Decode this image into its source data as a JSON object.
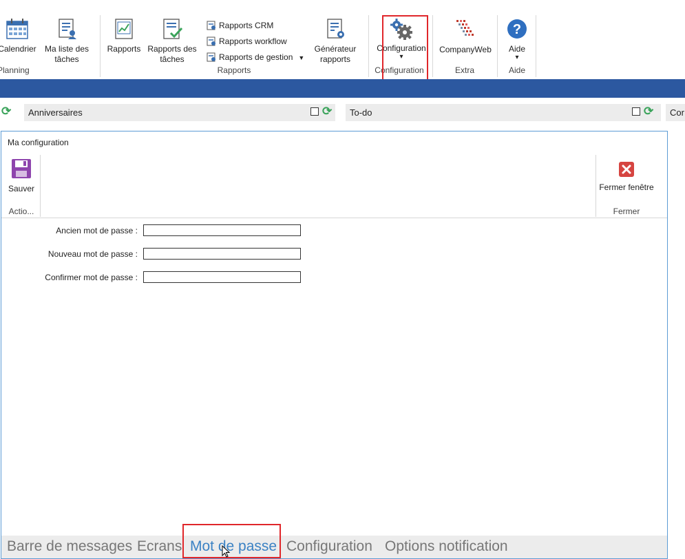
{
  "ribbon": {
    "planning": {
      "calendar_label": "Calendrier",
      "tasks_label_1": "Ma liste des",
      "tasks_label_2": "tâches",
      "group": "Planning"
    },
    "reports": {
      "rapports_label": "Rapports",
      "task_reports_1": "Rapports des",
      "task_reports_2": "tâches",
      "crm": "Rapports CRM",
      "workflow": "Rapports workflow",
      "management": "Rapports de gestion",
      "generator_1": "Générateur",
      "generator_2": "rapports",
      "group": "Rapports"
    },
    "configuration": {
      "label": "Configuration",
      "arrow": "▾",
      "group": "Configuration"
    },
    "extra": {
      "label": "CompanyWeb",
      "group": "Extra"
    },
    "help": {
      "label": "Aide",
      "arrow": "▾",
      "group": "Aide"
    }
  },
  "widgets": {
    "birthdays": "Anniversaires",
    "todo": "To-do",
    "third": "Cor"
  },
  "dialog": {
    "title": "Ma configuration",
    "save_label": "Sauver",
    "actions_group": "Actio...",
    "close_label": "Fermer fenêtre",
    "close_group": "Fermer",
    "fields": {
      "old_password_label": "Ancien mot de passe :",
      "new_password_label": "Nouveau mot de passe :",
      "confirm_password_label": "Confirmer mot de passe :",
      "old_password_value": "",
      "new_password_value": "",
      "confirm_password_value": ""
    },
    "tabs": [
      "Barre de messages",
      "Ecrans",
      "Mot de passe",
      "Configuration",
      "Options notification"
    ],
    "active_tab": "Mot de passe"
  },
  "colors": {
    "ribbon_bar": "#2c58a0",
    "highlight": "#e0262a",
    "active_tab": "#3b82c4"
  }
}
